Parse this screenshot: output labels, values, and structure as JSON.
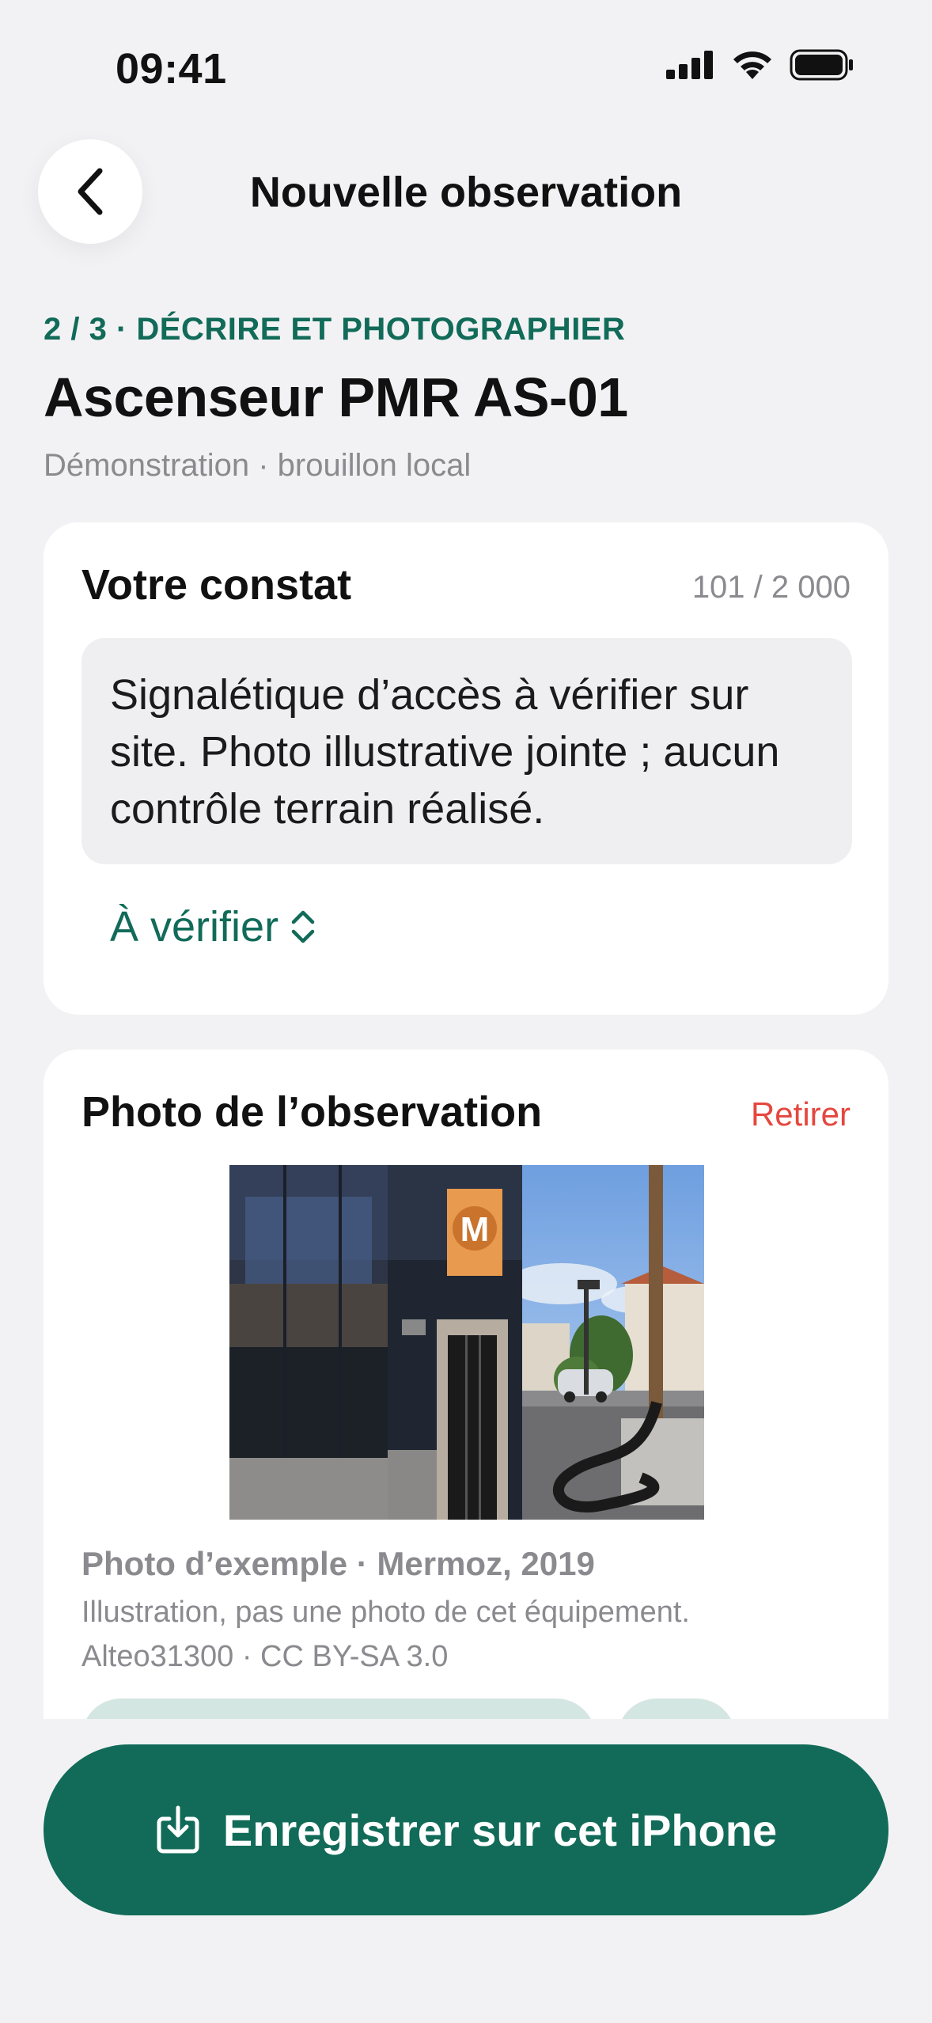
{
  "status_bar": {
    "time": "09:41"
  },
  "nav": {
    "title": "Nouvelle observation",
    "back_icon": "chevron-left-icon"
  },
  "header": {
    "step": "2 / 3 · DÉCRIRE ET PHOTOGRAPHIER",
    "title": "Ascenseur PMR AS-01",
    "subtitle": "Démonstration · brouillon local"
  },
  "constat": {
    "heading": "Votre constat",
    "counter": "101 / 2 000",
    "text": "Signalétique d’accès à vérifier sur site. Photo illustrative jointe ; aucun contrôle terrain réalisé.",
    "status_value": "À vérifier",
    "status_icon": "chevron-up-down-icon"
  },
  "photo_card": {
    "heading": "Photo de l’observation",
    "remove_label": "Retirer",
    "caption": "Photo d’exemple · Mermoz, 2019",
    "note": "Illustration, pas une photo de cet équipement.",
    "credit": "Alteo31300 · CC BY-SA 3.0"
  },
  "save_button": {
    "label": "Enregistrer sur cet iPhone",
    "icon": "save-download-icon"
  },
  "colors": {
    "accent": "#116b58",
    "danger": "#e5473f",
    "background": "#f2f2f4",
    "card": "#ffffff",
    "muted": "#8a8a8f"
  }
}
